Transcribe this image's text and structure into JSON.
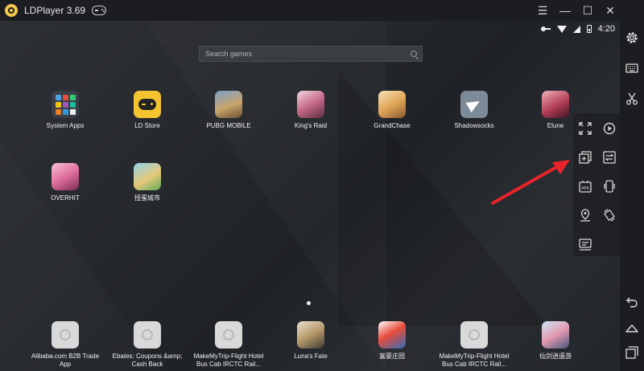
{
  "window": {
    "title": "LDPlayer 3.69",
    "controls": {
      "menu": "☰",
      "minimize": "—",
      "maximize": "☐",
      "close": "✕",
      "collapse": "«"
    }
  },
  "statusbar": {
    "time": "4:20"
  },
  "search": {
    "placeholder": "Search games"
  },
  "desktop_apps": [
    {
      "label": "System Apps",
      "icon": "system-apps-icon"
    },
    {
      "label": "LD Store",
      "icon": "ld-store-icon"
    },
    {
      "label": "PUBG MOBILE",
      "icon": "pubg-mobile-icon"
    },
    {
      "label": "King's Raid",
      "icon": "kings-raid-icon"
    },
    {
      "label": "GrandChase",
      "icon": "grandchase-icon"
    },
    {
      "label": "Shadowsocks",
      "icon": "shadowsocks-icon"
    },
    {
      "label": "Elune",
      "icon": "elune-icon"
    },
    {
      "label": "OVERHIT",
      "icon": "overhit-icon"
    },
    {
      "label": "扭蛋城市",
      "icon": "niudan-city-icon"
    }
  ],
  "dock_apps": [
    {
      "label": "Alibaba.com B2B Trade App",
      "icon": "alibaba-icon"
    },
    {
      "label": "Ebates: Coupons &amp; Cash Back",
      "icon": "ebates-icon"
    },
    {
      "label": "MakeMyTrip-Flight Hotel Bus Cab IRCTC Rail...",
      "icon": "makemytrip-icon"
    },
    {
      "label": "Luna's Fate",
      "icon": "lunas-fate-icon"
    },
    {
      "label": "富豪庄园",
      "icon": "fuhao-zhuangyuan-icon"
    },
    {
      "label": "MakeMyTrip-Flight Hotel Bus Cab IRCTC Rail...",
      "icon": "makemytrip-icon"
    },
    {
      "label": "仙剑逍遥游",
      "icon": "xianjian-icon"
    }
  ],
  "tools_panel": [
    "fullscreen-icon",
    "record-icon",
    "video-camera-icon",
    "multi-instance-icon",
    "sync-icon",
    "volume-up-icon",
    "apk-install-icon",
    "shake-icon",
    "volume-down-icon",
    "location-icon",
    "rotate-icon",
    "more-icon",
    "operation-record-icon"
  ],
  "sidebar": [
    "settings-icon",
    "keyboard-icon",
    "scissors-icon",
    "back-icon",
    "home-icon",
    "recent-apps-icon"
  ],
  "colors": {
    "titlebar": "#1b1d21",
    "screen": "#24272c",
    "accent_arrow": "#e8242b",
    "ld_store": "#f4c430"
  }
}
